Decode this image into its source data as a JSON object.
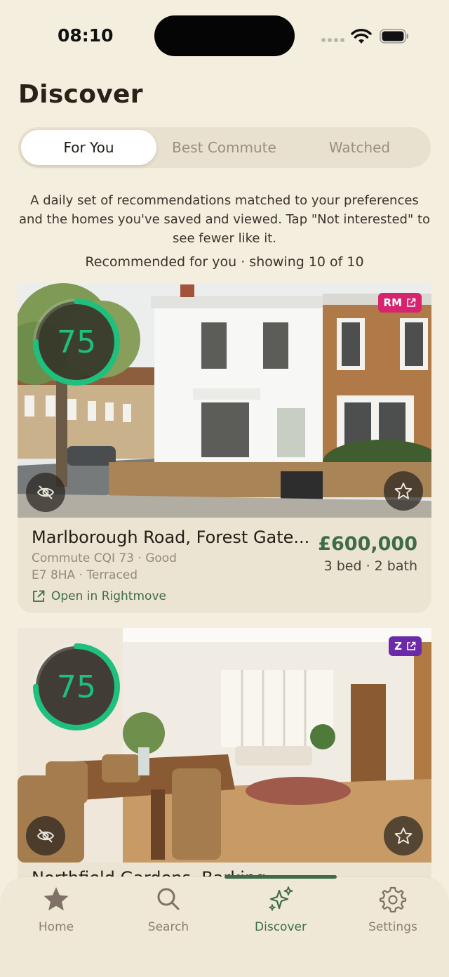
{
  "status_bar": {
    "time": "08:10"
  },
  "page": {
    "title": "Discover"
  },
  "segments": [
    {
      "label": "For You",
      "active": true
    },
    {
      "label": "Best Commute",
      "active": false
    },
    {
      "label": "Watched",
      "active": false
    }
  ],
  "intro_text": "A daily set of recommendations matched to your preferences and the homes you've saved and viewed. Tap \"Not interested\" to see fewer like it.",
  "recommendation_count": "Recommended for you · showing 10 of 10",
  "listings": [
    {
      "score": "75",
      "score_fraction": 0.75,
      "source_badge": "RM",
      "badge_color": "#d6246e",
      "title": "Marlborough Road, Forest Gate...",
      "price": "£600,000",
      "beds_baths": "3 bed · 2 bath",
      "commute": "Commute CQI 73 · Good",
      "location": "E7 8HA · Terraced",
      "link_label": "Open in Rightmove",
      "hide_icon": "eye-off-icon",
      "watch_icon": "star-outline-icon"
    },
    {
      "score": "75",
      "score_fraction": 0.75,
      "source_badge": "Z",
      "badge_color": "#6b2aa8",
      "title": "Northfield Gardens, Barking",
      "hide_icon": "eye-off-icon",
      "watch_icon": "star-outline-icon"
    }
  ],
  "tab_bar": {
    "tabs": [
      {
        "label": "Home",
        "icon": "star-icon",
        "active": false
      },
      {
        "label": "Search",
        "icon": "search-icon",
        "active": false
      },
      {
        "label": "Discover",
        "icon": "sparkles-icon",
        "active": true
      },
      {
        "label": "Settings",
        "icon": "gear-icon",
        "active": false
      }
    ]
  },
  "colors": {
    "accent": "#3f6b4b",
    "score": "#1fbf7d",
    "background": "#f4eedf"
  }
}
